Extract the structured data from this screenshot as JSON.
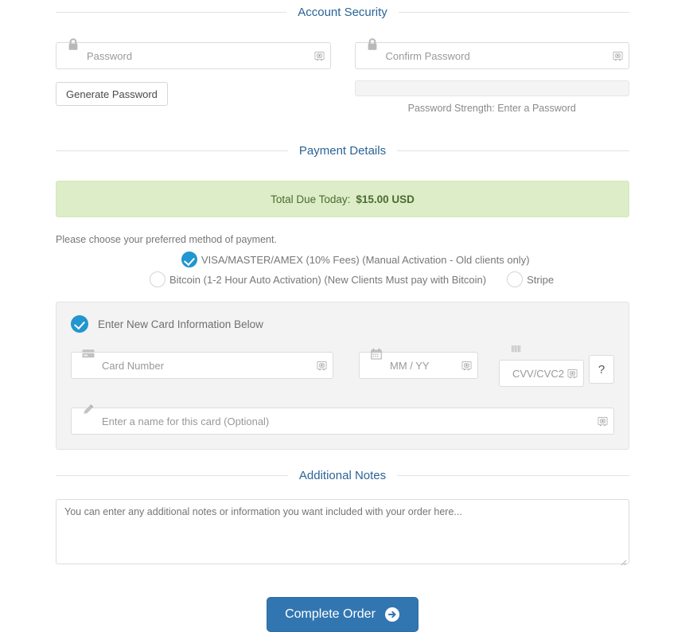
{
  "sections": {
    "account_security": "Account Security",
    "payment_details": "Payment Details",
    "additional_notes": "Additional Notes"
  },
  "account_security": {
    "password_placeholder": "Password",
    "confirm_password_placeholder": "Confirm Password",
    "generate_password_label": "Generate Password",
    "strength_label": "Password Strength: Enter a Password",
    "lock_icon": "lock-icon",
    "autofill_icon": "password-manager-icon"
  },
  "payment": {
    "total_due_label": "Total Due Today:",
    "total_due_amount": "$15.00 USD",
    "choose_note": "Please choose your preferred method of payment.",
    "methods": [
      {
        "label": "VISA/MASTER/AMEX (10% Fees) (Manual Activation - Old clients only)",
        "selected": true
      },
      {
        "label": "Bitcoin (1-2 Hour Auto Activation) (New Clients Must pay with Bitcoin)",
        "selected": false
      },
      {
        "label": "Stripe",
        "selected": false
      }
    ]
  },
  "card": {
    "new_card_label": "Enter New Card Information Below",
    "card_number_placeholder": "Card Number",
    "expiry_placeholder": "MM / YY",
    "cvv_placeholder": "CVV/CVC2",
    "card_name_placeholder": "Enter a name for this card (Optional)",
    "help_label": "?",
    "card_icon": "credit-card-icon",
    "calendar_icon": "calendar-icon",
    "barcode_icon": "barcode-icon",
    "pencil_icon": "pencil-icon"
  },
  "notes": {
    "placeholder": "You can enter any additional notes or information you want included with your order here..."
  },
  "submit": {
    "label": "Complete Order",
    "arrow_icon": "arrow-right-circle-icon"
  },
  "colors": {
    "heading": "#2a6496",
    "accent": "#2196cf",
    "primary_button": "#3276b1",
    "success_banner": "#dcedc8",
    "success_text": "#4a6b33"
  }
}
